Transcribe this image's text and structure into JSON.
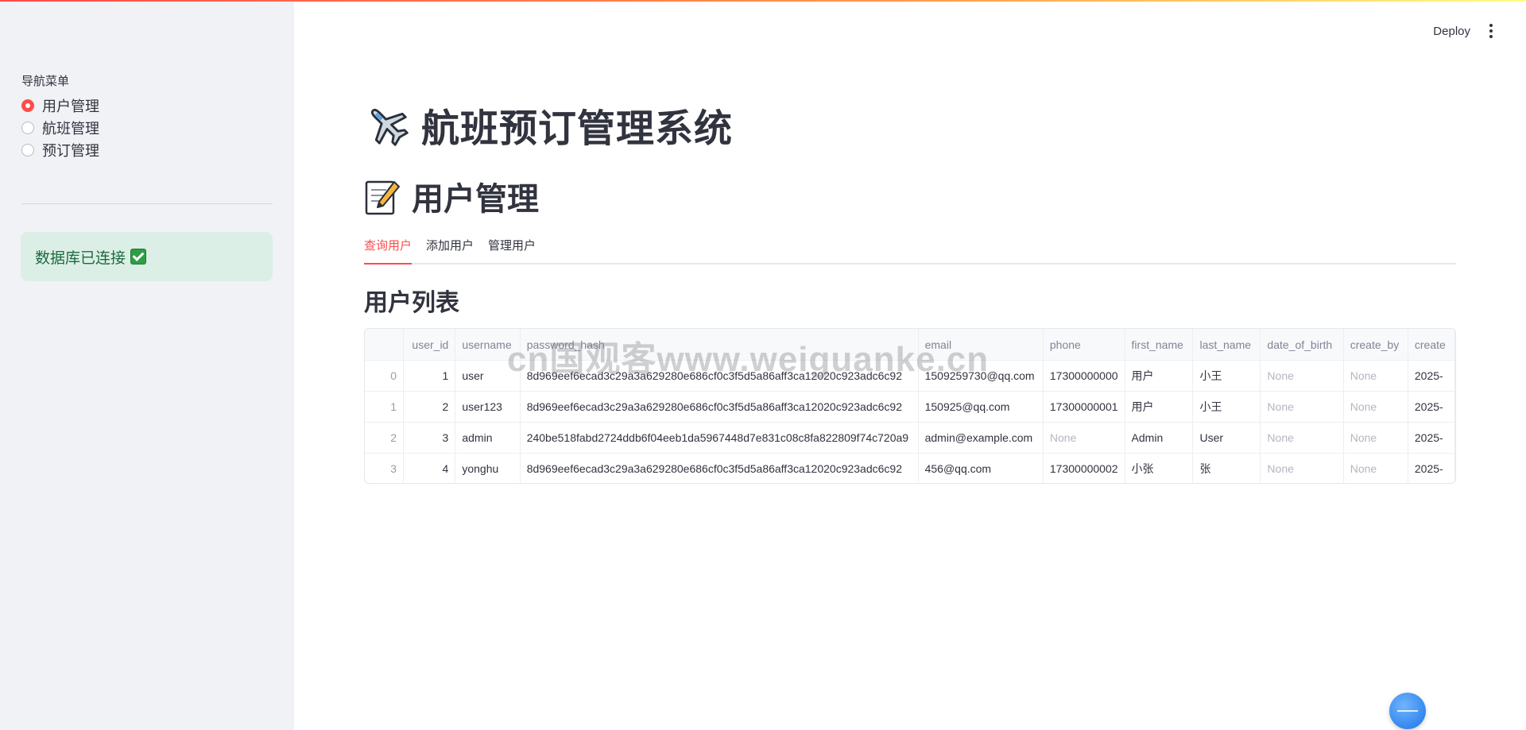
{
  "app": {
    "title": "航班预订管理系统",
    "section_title": "用户管理",
    "deploy_label": "Deploy",
    "watermark": "cn国观客www.weiguanke.cn"
  },
  "sidebar": {
    "nav_label": "导航菜单",
    "items": [
      {
        "label": "用户管理",
        "checked": true
      },
      {
        "label": "航班管理",
        "checked": false
      },
      {
        "label": "预订管理",
        "checked": false
      }
    ],
    "status_text": "数据库已连接"
  },
  "tabs": [
    "查询用户",
    "添加用户",
    "管理用户"
  ],
  "list_title": "用户列表",
  "table": {
    "headers": [
      "",
      "user_id",
      "username",
      "password_hash",
      "email",
      "phone",
      "first_name",
      "last_name",
      "date_of_birth",
      "create_by",
      "create"
    ],
    "rows": [
      [
        "0",
        "1",
        "user",
        "8d969eef6ecad3c29a3a629280e686cf0c3f5d5a86aff3ca12020c923adc6c92",
        "1509259730@qq.com",
        "17300000000",
        "用户",
        "小王",
        "None",
        "None",
        "2025-"
      ],
      [
        "1",
        "2",
        "user123",
        "8d969eef6ecad3c29a3a629280e686cf0c3f5d5a86aff3ca12020c923adc6c92",
        "150925@qq.com",
        "17300000001",
        "用户",
        "小王",
        "None",
        "None",
        "2025-"
      ],
      [
        "2",
        "3",
        "admin",
        "240be518fabd2724ddb6f04eeb1da5967448d7e831c08c8fa822809f74c720a9",
        "admin@example.com",
        "None",
        "Admin",
        "User",
        "None",
        "None",
        "2025-"
      ],
      [
        "3",
        "4",
        "yonghu",
        "8d969eef6ecad3c29a3a629280e686cf0c3f5d5a86aff3ca12020c923adc6c92",
        "456@qq.com",
        "17300000002",
        "小张",
        "张",
        "None",
        "None",
        "2025-"
      ]
    ]
  },
  "colors": {
    "accent": "#ff4b4b",
    "sidebar_bg": "#f0f2f6",
    "success_bg": "#dcefe6",
    "success_text": "#1d6a3f"
  },
  "icons": {
    "plane": "airplane-icon",
    "memo": "memo-icon",
    "check": "check-mark-icon",
    "menu": "kebab-menu-icon"
  }
}
